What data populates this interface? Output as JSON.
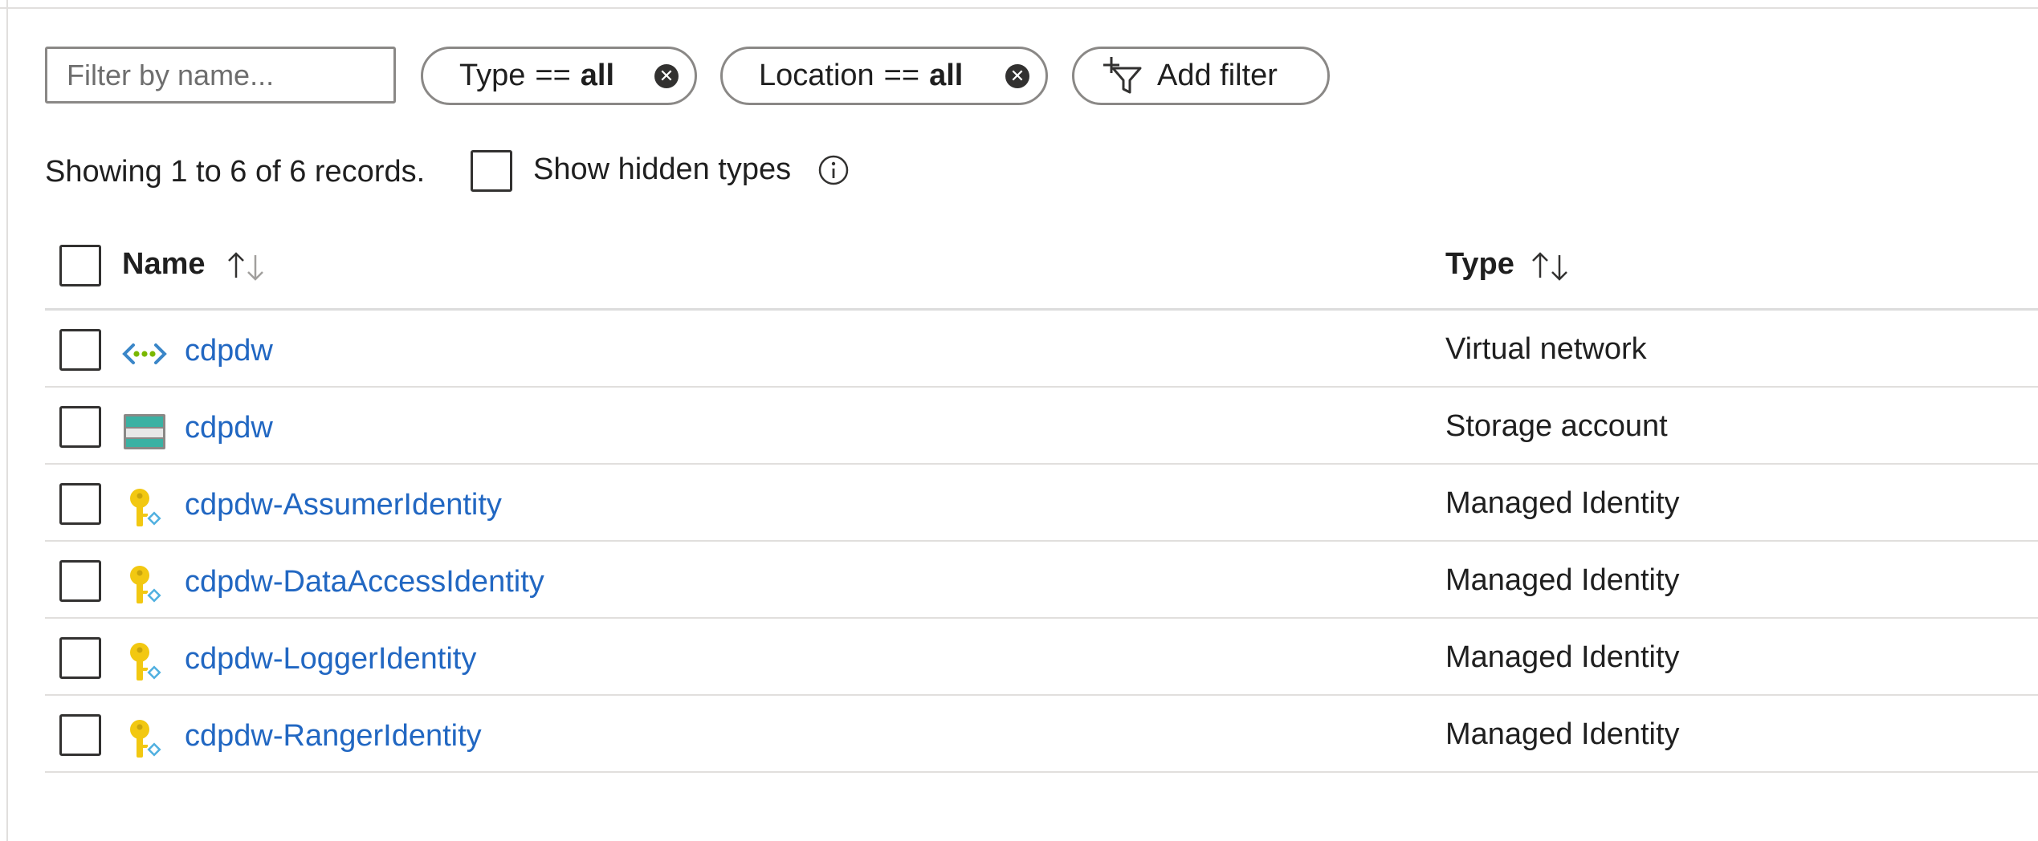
{
  "toolbar": {
    "filter_placeholder": "Filter by name...",
    "filters": [
      {
        "key": "Type",
        "operator": "==",
        "value": "all",
        "clear_icon": "clear-circle-icon"
      },
      {
        "key": "Location",
        "operator": "==",
        "value": "all",
        "clear_icon": "clear-circle-icon"
      }
    ],
    "add_filter_label": "Add filter",
    "add_filter_icon": "add-filter-icon"
  },
  "summary": {
    "showing_text": "Showing 1 to 6 of 6 records.",
    "show_hidden_label": "Show hidden types",
    "show_hidden_checked": false,
    "info_icon": "info-icon"
  },
  "table": {
    "columns": [
      {
        "label": "Name",
        "sort_icon": "sort-up-down-icon"
      },
      {
        "label": "Type",
        "sort_icon": "sort-up-down-icon"
      }
    ],
    "rows": [
      {
        "name": "cdpdw",
        "type": "Virtual network",
        "icon": "virtual-network-icon"
      },
      {
        "name": "cdpdw",
        "type": "Storage account",
        "icon": "storage-account-icon"
      },
      {
        "name": "cdpdw-AssumerIdentity",
        "type": "Managed Identity",
        "icon": "managed-identity-icon"
      },
      {
        "name": "cdpdw-DataAccessIdentity",
        "type": "Managed Identity",
        "icon": "managed-identity-icon"
      },
      {
        "name": "cdpdw-LoggerIdentity",
        "type": "Managed Identity",
        "icon": "managed-identity-icon"
      },
      {
        "name": "cdpdw-RangerIdentity",
        "type": "Managed Identity",
        "icon": "managed-identity-icon"
      }
    ]
  },
  "colors": {
    "link": "#2167c2",
    "text": "#1f1f1f",
    "border": "#8a8886",
    "divider": "#e1dfdd",
    "key_yellow": "#f2c811",
    "identity_badge": "#50b0e0",
    "storage_teal": "#3bb1a3"
  }
}
